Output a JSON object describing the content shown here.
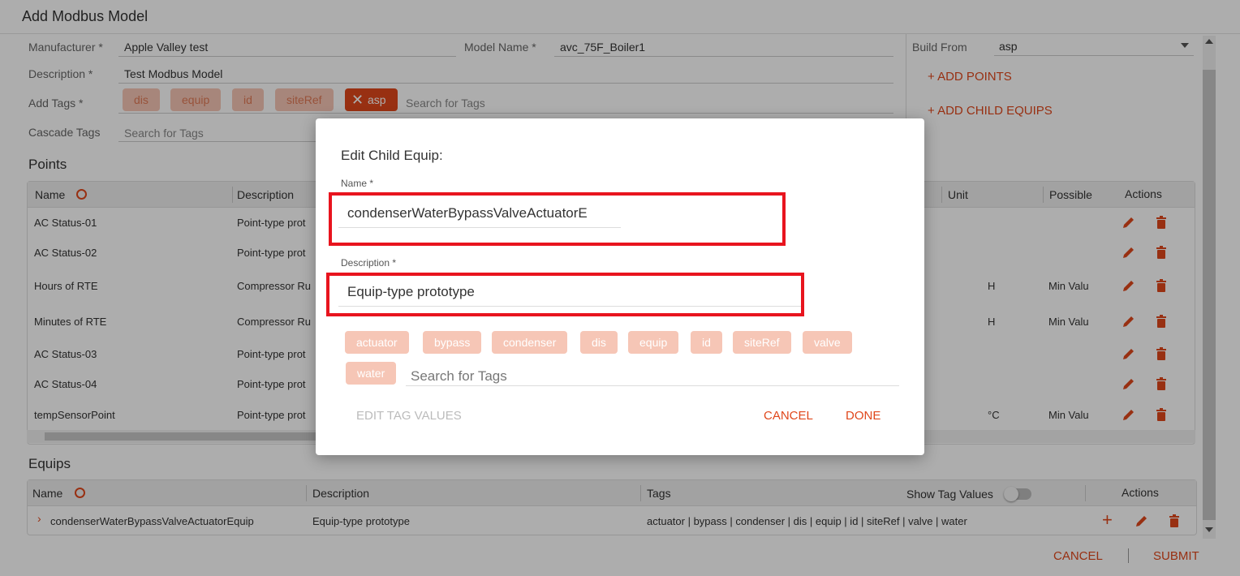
{
  "window": {
    "title": "Add Modbus Model"
  },
  "form": {
    "manufacturer_label": "Manufacturer *",
    "manufacturer_value": "Apple Valley test",
    "model_name_label": "Model Name *",
    "model_name_value": "avc_75F_Boiler1",
    "description_label": "Description *",
    "description_value": "Test Modbus Model",
    "add_tags_label": "Add Tags *",
    "tags": [
      "dis",
      "equip",
      "id",
      "siteRef"
    ],
    "selected_tag": "asp",
    "tags_search_placeholder": "Search for Tags",
    "cascade_tags_label": "Cascade Tags",
    "cascade_search_placeholder": "Search for Tags",
    "build_from_label": "Build From",
    "build_from_value": "asp",
    "add_points": "+ ADD POINTS",
    "add_child_equips": "+ ADD CHILD EQUIPS"
  },
  "points": {
    "title": "Points",
    "columns": {
      "name": "Name",
      "description": "Description",
      "unit": "Unit",
      "possible": "Possible",
      "actions": "Actions"
    },
    "rows": [
      {
        "name": "AC Status-01",
        "desc": "Point-type prot",
        "unit": "",
        "possible": ""
      },
      {
        "name": "AC Status-02",
        "desc": "Point-type prot",
        "unit": "",
        "possible": ""
      },
      {
        "name": "Hours of RTE",
        "desc": "Compressor Ru",
        "unit": "H",
        "possible": "Min Valu"
      },
      {
        "name": "Minutes of RTE",
        "desc": "Compressor Ru",
        "unit": "H",
        "possible": "Min Valu"
      },
      {
        "name": "AC Status-03",
        "desc": "Point-type prot",
        "unit": "",
        "possible": ""
      },
      {
        "name": "AC Status-04",
        "desc": "Point-type prot",
        "unit": "",
        "possible": ""
      },
      {
        "name": "tempSensorPoint",
        "desc": "Point-type prot",
        "unit": "°C",
        "possible": "Min Valu"
      }
    ]
  },
  "equips": {
    "title": "Equips",
    "columns": {
      "name": "Name",
      "description": "Description",
      "tags": "Tags",
      "show_tag_values": "Show Tag Values",
      "actions": "Actions"
    },
    "row": {
      "name": "condenserWaterBypassValveActuatorEquip",
      "description": "Equip-type prototype",
      "tags": "actuator | bypass | condenser | dis | equip | id | siteRef | valve | water"
    }
  },
  "footer": {
    "cancel": "CANCEL",
    "submit": "SUBMIT"
  },
  "modal": {
    "title": "Edit Child Equip:",
    "name_label": "Name *",
    "name_value": "condenserWaterBypassValveActuatorE",
    "description_label": "Description *",
    "description_value": "Equip-type prototype",
    "tags": [
      "actuator",
      "bypass",
      "condenser",
      "dis",
      "equip",
      "id",
      "siteRef",
      "valve",
      "water"
    ],
    "tags_search_placeholder": "Search for Tags",
    "edit_tag_values": "EDIT TAG VALUES",
    "cancel": "CANCEL",
    "done": "DONE"
  },
  "colors": {
    "accent": "#e0471b",
    "tag_bg": "#f6c6b6",
    "highlight": "#e8141e"
  }
}
